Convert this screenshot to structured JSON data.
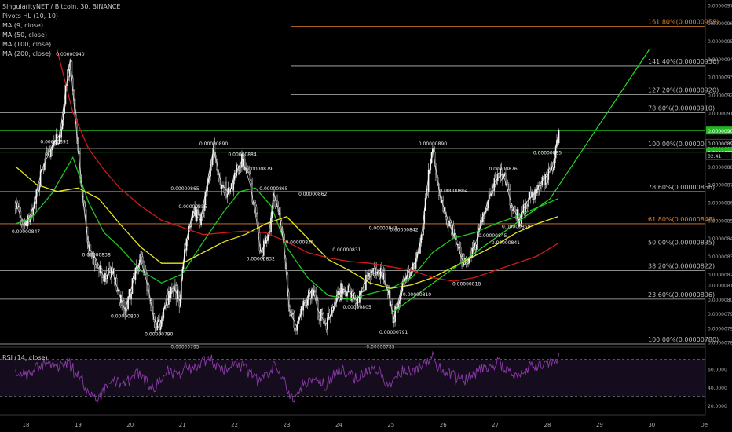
{
  "legend": {
    "symbol": "SingularityNET / Bitcoin, 30, BINANCE",
    "indicators": [
      "Pivots HL (10, 10)",
      "MA (9, close)",
      "MA (50, close)",
      "MA (100, close)",
      "MA (200, close)"
    ],
    "rsi": "RSI (14, close)"
  },
  "chart_data": {
    "type": "candlestick",
    "x_ticks": [
      "18",
      "19",
      "20",
      "21",
      "22",
      "23",
      "24",
      "25",
      "26",
      "27",
      "28",
      "29",
      "30",
      "De"
    ],
    "price_ticks": [
      "0.00000970",
      "0.00000960",
      "0.00000950",
      "0.00000940",
      "0.00000930",
      "0.00000920",
      "0.00000910",
      "0.00000900",
      "0.00000890",
      "0.00000880",
      "0.00000870",
      "0.00000860",
      "0.00000850",
      "0.00000840",
      "0.00000830",
      "0.00000820",
      "0.00000814",
      "0.00000806",
      "0.00000798",
      "0.00000790",
      "0.00000782"
    ],
    "price_range": [
      7.81e-06,
      9.71e-06
    ],
    "price_path": [
      [
        17.8,
        8.6e-06
      ],
      [
        17.9,
        8.52e-06
      ],
      [
        18.0,
        8.47e-06
      ],
      [
        18.15,
        8.58e-06
      ],
      [
        18.3,
        8.78e-06
      ],
      [
        18.5,
        8.91e-06
      ],
      [
        18.65,
        8.98e-06
      ],
      [
        18.75,
        9.2e-06
      ],
      [
        18.85,
        9.4e-06
      ],
      [
        18.92,
        9.15e-06
      ],
      [
        19.0,
        8.9e-06
      ],
      [
        19.1,
        8.6e-06
      ],
      [
        19.2,
        8.35e-06
      ],
      [
        19.35,
        8.28e-06
      ],
      [
        19.5,
        8.18e-06
      ],
      [
        19.65,
        8.22e-06
      ],
      [
        19.8,
        8.08e-06
      ],
      [
        19.9,
        8e-06
      ],
      [
        20.05,
        8.15e-06
      ],
      [
        20.2,
        8.28e-06
      ],
      [
        20.35,
        8.12e-06
      ],
      [
        20.45,
        7.95e-06
      ],
      [
        20.55,
        7.9e-06
      ],
      [
        20.7,
        8.05e-06
      ],
      [
        20.85,
        8.12e-06
      ],
      [
        20.95,
        8.05e-06
      ],
      [
        21.05,
        8.35e-06
      ],
      [
        21.2,
        8.55e-06
      ],
      [
        21.35,
        8.5e-06
      ],
      [
        21.5,
        8.75e-06
      ],
      [
        21.6,
        8.9e-06
      ],
      [
        21.75,
        8.7e-06
      ],
      [
        21.9,
        8.65e-06
      ],
      [
        22.0,
        8.75e-06
      ],
      [
        22.15,
        8.84e-06
      ],
      [
        22.3,
        8.7e-06
      ],
      [
        22.42,
        8.5e-06
      ],
      [
        22.5,
        8.32e-06
      ],
      [
        22.65,
        8.4e-06
      ],
      [
        22.75,
        8.65e-06
      ],
      [
        22.85,
        8.55e-06
      ],
      [
        22.95,
        8.35e-06
      ],
      [
        23.05,
        8e-06
      ],
      [
        23.2,
        7.9e-06
      ],
      [
        23.35,
        8.05e-06
      ],
      [
        23.5,
        8.12e-06
      ],
      [
        23.6,
        8e-06
      ],
      [
        23.75,
        7.92e-06
      ],
      [
        23.9,
        8e-06
      ],
      [
        24.05,
        8.12e-06
      ],
      [
        24.2,
        8.1e-06
      ],
      [
        24.35,
        8.05e-06
      ],
      [
        24.5,
        8.15e-06
      ],
      [
        24.65,
        8.2e-06
      ],
      [
        24.8,
        8.22e-06
      ],
      [
        24.95,
        8.1e-06
      ],
      [
        25.05,
        7.95e-06
      ],
      [
        25.2,
        8.12e-06
      ],
      [
        25.35,
        8.22e-06
      ],
      [
        25.5,
        8.28e-06
      ],
      [
        25.6,
        8.45e-06
      ],
      [
        25.7,
        8.7e-06
      ],
      [
        25.8,
        8.9e-06
      ],
      [
        25.95,
        8.62e-06
      ],
      [
        26.1,
        8.5e-06
      ],
      [
        26.25,
        8.38e-06
      ],
      [
        26.4,
        8.25e-06
      ],
      [
        26.55,
        8.3e-06
      ],
      [
        26.7,
        8.45e-06
      ],
      [
        26.85,
        8.6e-06
      ],
      [
        27.0,
        8.72e-06
      ],
      [
        27.15,
        8.76e-06
      ],
      [
        27.3,
        8.6e-06
      ],
      [
        27.45,
        8.5e-06
      ],
      [
        27.6,
        8.6e-06
      ],
      [
        27.75,
        8.65e-06
      ],
      [
        27.9,
        8.72e-06
      ],
      [
        28.0,
        8.75e-06
      ],
      [
        28.1,
        8.8e-06
      ],
      [
        28.22,
        9e-06
      ]
    ],
    "moving_averages": [
      {
        "name": "MA (50, close)",
        "color": "#22c522",
        "points": [
          [
            17.8,
            8.48e-06
          ],
          [
            18.1,
            8.51e-06
          ],
          [
            18.5,
            8.65e-06
          ],
          [
            18.9,
            8.85e-06
          ],
          [
            19.2,
            8.6e-06
          ],
          [
            19.5,
            8.43e-06
          ],
          [
            19.8,
            8.35e-06
          ],
          [
            20.2,
            8.22e-06
          ],
          [
            20.6,
            8.15e-06
          ],
          [
            21.0,
            8.2e-06
          ],
          [
            21.4,
            8.38e-06
          ],
          [
            21.8,
            8.55e-06
          ],
          [
            22.1,
            8.66e-06
          ],
          [
            22.4,
            8.68e-06
          ],
          [
            22.7,
            8.58e-06
          ],
          [
            23.0,
            8.35e-06
          ],
          [
            23.4,
            8.18e-06
          ],
          [
            23.8,
            8.08e-06
          ],
          [
            24.2,
            8.06e-06
          ],
          [
            24.6,
            8.09e-06
          ],
          [
            25.0,
            8.12e-06
          ],
          [
            25.4,
            8.18e-06
          ],
          [
            25.8,
            8.32e-06
          ],
          [
            26.2,
            8.4e-06
          ],
          [
            26.6,
            8.43e-06
          ],
          [
            27.0,
            8.48e-06
          ],
          [
            27.4,
            8.52e-06
          ],
          [
            27.8,
            8.57e-06
          ],
          [
            28.2,
            8.62e-06
          ]
        ]
      },
      {
        "name": "MA (100, close)",
        "color": "#e6e61e",
        "points": [
          [
            17.8,
            8.8e-06
          ],
          [
            18.2,
            8.7e-06
          ],
          [
            18.6,
            8.66e-06
          ],
          [
            19.0,
            8.68e-06
          ],
          [
            19.4,
            8.62e-06
          ],
          [
            19.8,
            8.48e-06
          ],
          [
            20.2,
            8.35e-06
          ],
          [
            20.6,
            8.26e-06
          ],
          [
            21.0,
            8.26e-06
          ],
          [
            21.4,
            8.32e-06
          ],
          [
            21.8,
            8.38e-06
          ],
          [
            22.2,
            8.42e-06
          ],
          [
            22.6,
            8.48e-06
          ],
          [
            23.0,
            8.52e-06
          ],
          [
            23.4,
            8.4e-06
          ],
          [
            23.8,
            8.28e-06
          ],
          [
            24.2,
            8.22e-06
          ],
          [
            24.6,
            8.15e-06
          ],
          [
            25.0,
            8.12e-06
          ],
          [
            25.4,
            8.14e-06
          ],
          [
            25.8,
            8.18e-06
          ],
          [
            26.2,
            8.24e-06
          ],
          [
            26.6,
            8.3e-06
          ],
          [
            27.0,
            8.36e-06
          ],
          [
            27.4,
            8.43e-06
          ],
          [
            27.8,
            8.48e-06
          ],
          [
            28.2,
            8.52e-06
          ]
        ]
      },
      {
        "name": "MA (200, close)",
        "color": "#d11a1a",
        "points": [
          [
            18.6,
            9.45e-06
          ],
          [
            18.9,
            9.1e-06
          ],
          [
            19.2,
            8.9e-06
          ],
          [
            19.5,
            8.78e-06
          ],
          [
            19.8,
            8.68e-06
          ],
          [
            20.2,
            8.58e-06
          ],
          [
            20.6,
            8.5e-06
          ],
          [
            21.0,
            8.46e-06
          ],
          [
            21.4,
            8.42e-06
          ],
          [
            21.8,
            8.43e-06
          ],
          [
            22.2,
            8.44e-06
          ],
          [
            22.6,
            8.43e-06
          ],
          [
            23.0,
            8.38e-06
          ],
          [
            23.4,
            8.32e-06
          ],
          [
            23.8,
            8.29e-06
          ],
          [
            24.2,
            8.27e-06
          ],
          [
            24.6,
            8.26e-06
          ],
          [
            25.0,
            8.24e-06
          ],
          [
            25.4,
            8.22e-06
          ],
          [
            25.8,
            8.18e-06
          ],
          [
            26.2,
            8.16e-06
          ],
          [
            26.6,
            8.18e-06
          ],
          [
            27.0,
            8.22e-06
          ],
          [
            27.4,
            8.26e-06
          ],
          [
            27.8,
            8.3e-06
          ],
          [
            28.2,
            8.37e-06
          ]
        ]
      }
    ],
    "fib_levels": [
      {
        "label": "161.80%(0.00000958)",
        "value": 9.58e-06,
        "color": "#e07f2a"
      },
      {
        "label": "141.40%(0.00000936)",
        "value": 9.36e-06,
        "color": "#bbbbbb"
      },
      {
        "label": "127.20%(0.00000920)",
        "value": 9.2e-06,
        "color": "#bbbbbb"
      },
      {
        "label": "78.60%(0.00000910)",
        "value": 9.1e-06,
        "color": "#bbbbbb"
      },
      {
        "label": "100.00%(0.00000890)",
        "value": 8.9e-06,
        "color": "#bbbbbb"
      },
      {
        "label": "78.60%(0.00000866)",
        "value": 8.66e-06,
        "color": "#bbbbbb"
      },
      {
        "label": "61.80%(0.00000848)",
        "value": 8.48e-06,
        "color": "#e07f2a"
      },
      {
        "label": "50.00%(0.00000835)",
        "value": 8.35e-06,
        "color": "#bbbbbb"
      },
      {
        "label": "38.20%(0.00000822)",
        "value": 8.22e-06,
        "color": "#bbbbbb"
      },
      {
        "label": "23.60%(0.00000806)",
        "value": 8.06e-06,
        "color": "#bbbbbb"
      },
      {
        "label": "100.00%(0.00000780)",
        "value": 7.81e-06,
        "color": "#bbbbbb"
      }
    ],
    "horizontal_lines": [
      {
        "value": 9e-06,
        "color": "#22dd22",
        "price_tag": "0.00000900"
      },
      {
        "value": 8.88e-06,
        "color": "#22dd22",
        "price_tag": "0.00000888"
      }
    ],
    "trend_lines": [
      {
        "from": [
          25.0,
          7.98e-06
        ],
        "to": [
          28.05,
          8.62e-06
        ],
        "color": "#22dd22"
      },
      {
        "from": [
          28.05,
          8.62e-06
        ],
        "to": [
          29.95,
          9.45e-06
        ],
        "color": "#22dd22"
      }
    ],
    "current_price_tags": [
      {
        "text": "0.00000893",
        "value": 8.93e-06
      },
      {
        "text": "02:41",
        "value": 8.86e-06
      }
    ],
    "pivot_labels": [
      {
        "text": "0.00000940",
        "x": 18.85,
        "y": 9.4e-06,
        "pos": "above"
      },
      {
        "text": "0.00000891",
        "x": 18.55,
        "y": 8.91e-06,
        "pos": "above"
      },
      {
        "text": "0.00000847",
        "x": 18.0,
        "y": 8.47e-06,
        "pos": "below"
      },
      {
        "text": "0.00000838",
        "x": 19.35,
        "y": 8.28e-06,
        "pos": "above"
      },
      {
        "text": "0.00000800",
        "x": 19.9,
        "y": 8e-06,
        "pos": "below"
      },
      {
        "text": "0.00000790",
        "x": 20.55,
        "y": 7.9e-06,
        "pos": "below"
      },
      {
        "text": "0.00000855",
        "x": 21.2,
        "y": 8.55e-06,
        "pos": "above"
      },
      {
        "text": "0.00000865",
        "x": 21.05,
        "y": 8.65e-06,
        "pos": "above"
      },
      {
        "text": "0.00000795",
        "x": 21.05,
        "y": 7.83e-06,
        "pos": "below"
      },
      {
        "text": "0.00000890",
        "x": 21.6,
        "y": 8.9e-06,
        "pos": "above"
      },
      {
        "text": "0.00000884",
        "x": 22.15,
        "y": 8.84e-06,
        "pos": "above"
      },
      {
        "text": "0.00000879",
        "x": 22.45,
        "y": 8.76e-06,
        "pos": "above"
      },
      {
        "text": "0.00000832",
        "x": 22.5,
        "y": 8.32e-06,
        "pos": "below"
      },
      {
        "text": "0.00000865",
        "x": 22.75,
        "y": 8.65e-06,
        "pos": "above"
      },
      {
        "text": "0.00000862",
        "x": 23.5,
        "y": 8.62e-06,
        "pos": "above"
      },
      {
        "text": "0.00000835",
        "x": 23.25,
        "y": 8.35e-06,
        "pos": "above"
      },
      {
        "text": "0.00000831",
        "x": 24.15,
        "y": 8.31e-06,
        "pos": "above"
      },
      {
        "text": "0.00000805",
        "x": 24.35,
        "y": 8.05e-06,
        "pos": "below"
      },
      {
        "text": "0.00000843",
        "x": 24.85,
        "y": 8.43e-06,
        "pos": "above"
      },
      {
        "text": "0.00000842",
        "x": 25.25,
        "y": 8.42e-06,
        "pos": "above"
      },
      {
        "text": "0.00000785",
        "x": 24.8,
        "y": 7.83e-06,
        "pos": "below"
      },
      {
        "text": "0.00000791",
        "x": 25.05,
        "y": 7.91e-06,
        "pos": "below"
      },
      {
        "text": "0.00000810",
        "x": 25.5,
        "y": 8.12e-06,
        "pos": "below"
      },
      {
        "text": "0.00000890",
        "x": 25.8,
        "y": 8.9e-06,
        "pos": "above"
      },
      {
        "text": "0.00000864",
        "x": 26.2,
        "y": 8.64e-06,
        "pos": "above"
      },
      {
        "text": "0.00000818",
        "x": 26.45,
        "y": 8.18e-06,
        "pos": "below"
      },
      {
        "text": "0.00000876",
        "x": 27.15,
        "y": 8.76e-06,
        "pos": "above"
      },
      {
        "text": "0.00000885",
        "x": 28.0,
        "y": 8.85e-06,
        "pos": "above"
      },
      {
        "text": "0.00000850",
        "x": 27.4,
        "y": 8.5e-06,
        "pos": "below"
      },
      {
        "text": "0.00000845",
        "x": 26.95,
        "y": 8.45e-06,
        "pos": "below"
      },
      {
        "text": "0.00000841",
        "x": 27.2,
        "y": 8.41e-06,
        "pos": "below"
      }
    ],
    "rsi": {
      "ticks": [
        "60.0000",
        "40.0000",
        "20.0000"
      ],
      "range": [
        15,
        80
      ],
      "levels": [
        70,
        30
      ],
      "color": "#8a3aa8",
      "points": [
        [
          17.8,
          58
        ],
        [
          18.0,
          52
        ],
        [
          18.2,
          62
        ],
        [
          18.4,
          66
        ],
        [
          18.6,
          60
        ],
        [
          18.8,
          68
        ],
        [
          18.95,
          55
        ],
        [
          19.1,
          45
        ],
        [
          19.25,
          32
        ],
        [
          19.4,
          28
        ],
        [
          19.55,
          40
        ],
        [
          19.7,
          48
        ],
        [
          19.85,
          38
        ],
        [
          20.0,
          50
        ],
        [
          20.15,
          56
        ],
        [
          20.3,
          45
        ],
        [
          20.45,
          40
        ],
        [
          20.6,
          52
        ],
        [
          20.75,
          58
        ],
        [
          20.9,
          50
        ],
        [
          21.05,
          62
        ],
        [
          21.2,
          58
        ],
        [
          21.4,
          66
        ],
        [
          21.55,
          70
        ],
        [
          21.7,
          58
        ],
        [
          21.85,
          62
        ],
        [
          22.0,
          66
        ],
        [
          22.15,
          64
        ],
        [
          22.3,
          55
        ],
        [
          22.45,
          45
        ],
        [
          22.6,
          52
        ],
        [
          22.75,
          62
        ],
        [
          22.9,
          55
        ],
        [
          23.05,
          30
        ],
        [
          23.15,
          24
        ],
        [
          23.3,
          42
        ],
        [
          23.45,
          48
        ],
        [
          23.6,
          45
        ],
        [
          23.75,
          42
        ],
        [
          23.9,
          52
        ],
        [
          24.05,
          58
        ],
        [
          24.2,
          52
        ],
        [
          24.35,
          50
        ],
        [
          24.5,
          58
        ],
        [
          24.65,
          60
        ],
        [
          24.8,
          55
        ],
        [
          24.95,
          42
        ],
        [
          25.1,
          52
        ],
        [
          25.25,
          58
        ],
        [
          25.4,
          55
        ],
        [
          25.55,
          62
        ],
        [
          25.7,
          70
        ],
        [
          25.8,
          74
        ],
        [
          25.95,
          60
        ],
        [
          26.1,
          55
        ],
        [
          26.25,
          50
        ],
        [
          26.4,
          48
        ],
        [
          26.55,
          52
        ],
        [
          26.7,
          58
        ],
        [
          26.85,
          62
        ],
        [
          27.0,
          66
        ],
        [
          27.15,
          64
        ],
        [
          27.3,
          55
        ],
        [
          27.45,
          52
        ],
        [
          27.6,
          60
        ],
        [
          27.75,
          64
        ],
        [
          27.9,
          62
        ],
        [
          28.05,
          66
        ],
        [
          28.15,
          62
        ],
        [
          28.22,
          76
        ]
      ]
    }
  }
}
